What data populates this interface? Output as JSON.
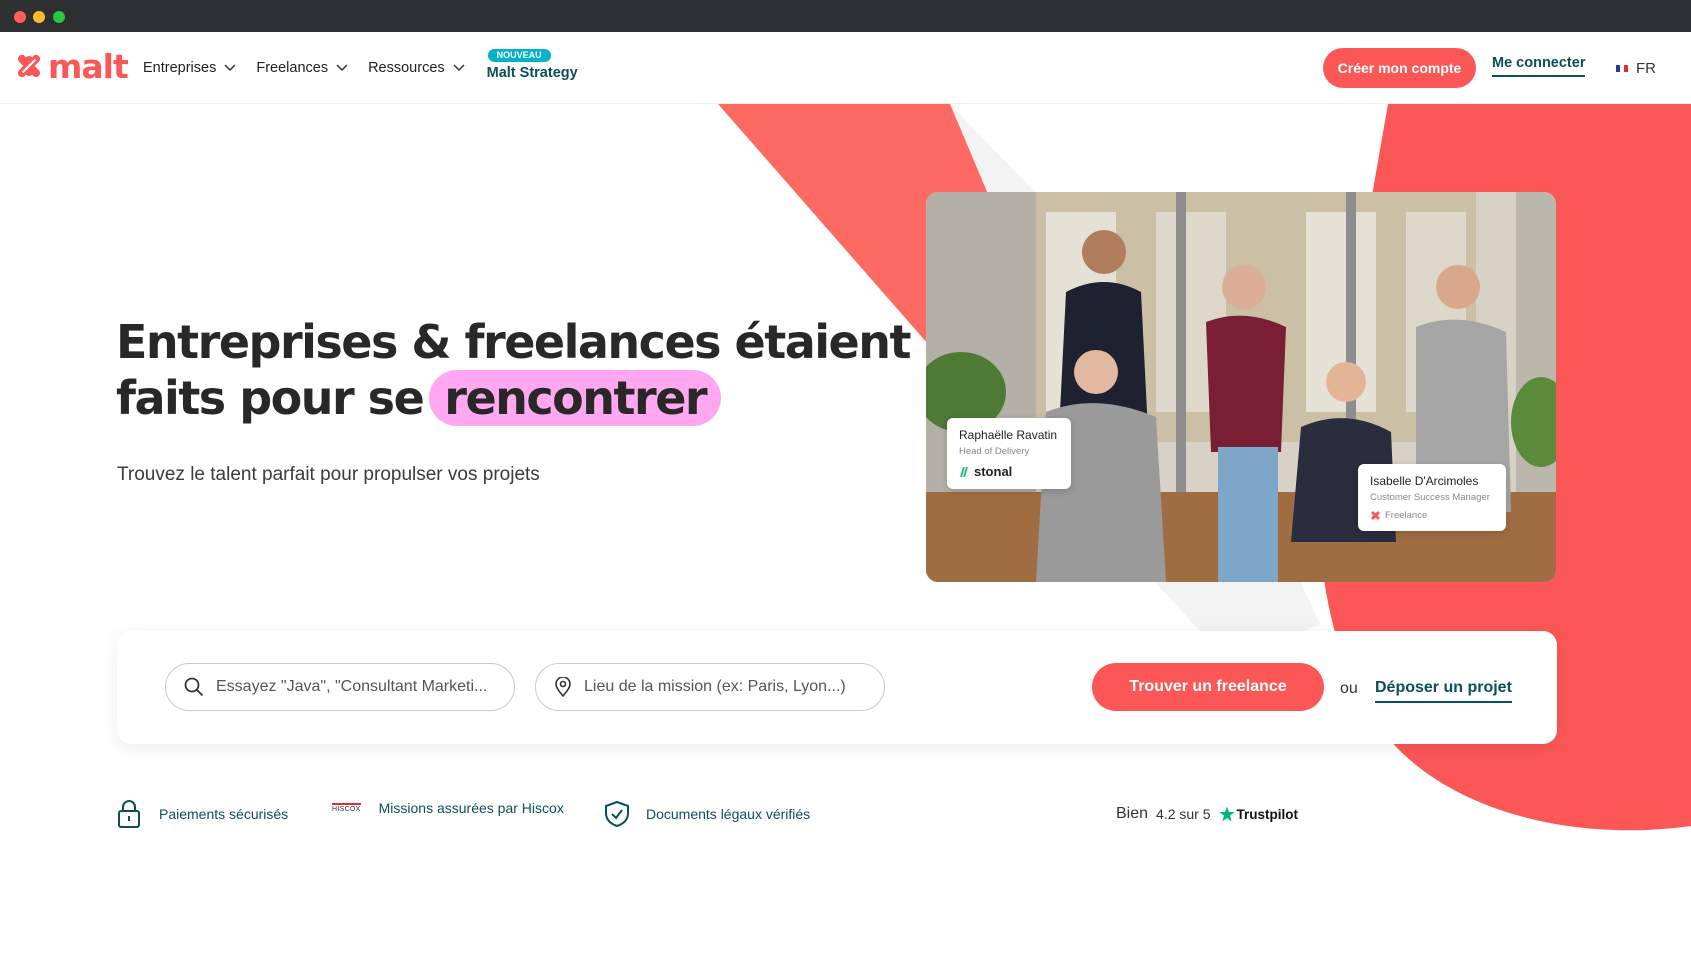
{
  "window": {
    "controls": [
      "close",
      "minimize",
      "maximize"
    ]
  },
  "header": {
    "logo_text": "malt",
    "nav": [
      {
        "label": "Entreprises"
      },
      {
        "label": "Freelances"
      },
      {
        "label": "Ressources"
      }
    ],
    "strategy": {
      "badge": "NOUVEAU",
      "label": "Malt Strategy"
    },
    "create_account": "Créer mon compte",
    "login": "Me connecter",
    "language": "FR"
  },
  "hero": {
    "title_line1": "Entreprises & freelances étaient",
    "title_line2_prefix": "faits pour se",
    "title_highlight": "rencontrer",
    "subtitle": "Trouvez le talent parfait pour propulser vos projets"
  },
  "photo": {
    "card1": {
      "name": "Raphaëlle Ravatin",
      "role": "Head of Delivery",
      "company": "stonal"
    },
    "card2": {
      "name": "Isabelle D'Arcimoles",
      "role": "Customer Success Manager",
      "company": "Freelance"
    }
  },
  "search": {
    "skill_placeholder": "Essayez \"Java\", \"Consultant Marketi...",
    "location_placeholder": "Lieu de la mission (ex: Paris, Lyon...)",
    "find_button": "Trouver un freelance",
    "or_text": "ou",
    "post_project": "Déposer un projet"
  },
  "trust": [
    {
      "label": "Paiements sécurisés",
      "icon": "lock-icon"
    },
    {
      "label": "Missions assurées par Hiscox",
      "icon": "hiscox-logo",
      "logo_text": "HISCOX"
    },
    {
      "label": "Documents légaux vérifiés",
      "icon": "shield-check-icon"
    }
  ],
  "trustpilot": {
    "word": "Bien",
    "rating": "4.2 sur 5",
    "brand": "Trustpilot"
  },
  "colors": {
    "brand": "#fc5757",
    "teal": "#0b4f5c",
    "highlight": "#ffa8f1",
    "badge": "#00b3c7"
  }
}
